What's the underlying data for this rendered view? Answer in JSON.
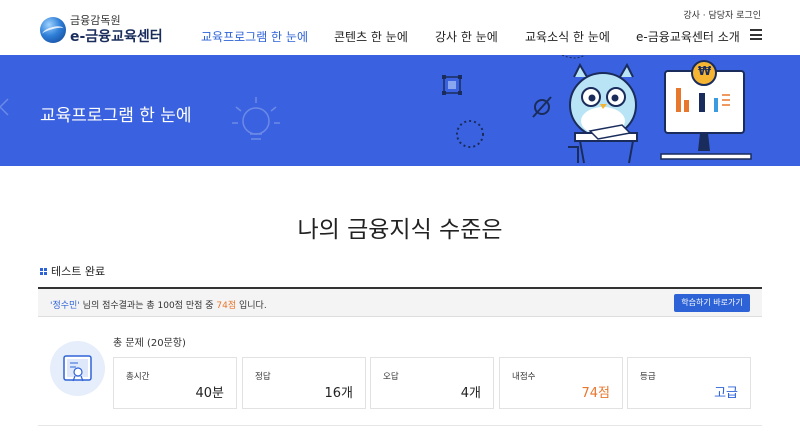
{
  "header": {
    "logo_top": "금융감독원",
    "logo_bottom": "e-금융교육센터",
    "util_link": "강사 · 담당자 로그인",
    "nav": [
      {
        "label": "교육프로그램 한 눈에",
        "active": true
      },
      {
        "label": "콘텐츠 한 눈에",
        "active": false
      },
      {
        "label": "강사 한 눈에",
        "active": false
      },
      {
        "label": "교육소식 한 눈에",
        "active": false
      },
      {
        "label": "e-금융교육센터 소개",
        "active": false
      }
    ],
    "menu_icon": "hamburger-menu-icon"
  },
  "banner": {
    "title": "교육프로그램 한 눈에",
    "illustration_text": "₩"
  },
  "main": {
    "title": "나의 금융지식 수준은",
    "section_label": "테스트 완료",
    "result": {
      "name": "'정수민'",
      "text_a": "님의 점수결과는 총 100점 만점 중",
      "score": "74점",
      "text_b": "입니다.",
      "button": "학습하기 바로가기"
    },
    "total": "총 문제 (20문항)",
    "stats": [
      {
        "label": "총시간",
        "value": "40분",
        "color": "default"
      },
      {
        "label": "정답",
        "value": "16개",
        "color": "default"
      },
      {
        "label": "오답",
        "value": "4개",
        "color": "default"
      },
      {
        "label": "내점수",
        "value": "74점",
        "color": "orange"
      },
      {
        "label": "등급",
        "value": "고급",
        "color": "blue"
      }
    ]
  },
  "colors": {
    "accent_blue": "#2e63d8",
    "banner_blue": "#3a62e0",
    "score_orange": "#e8772e"
  }
}
